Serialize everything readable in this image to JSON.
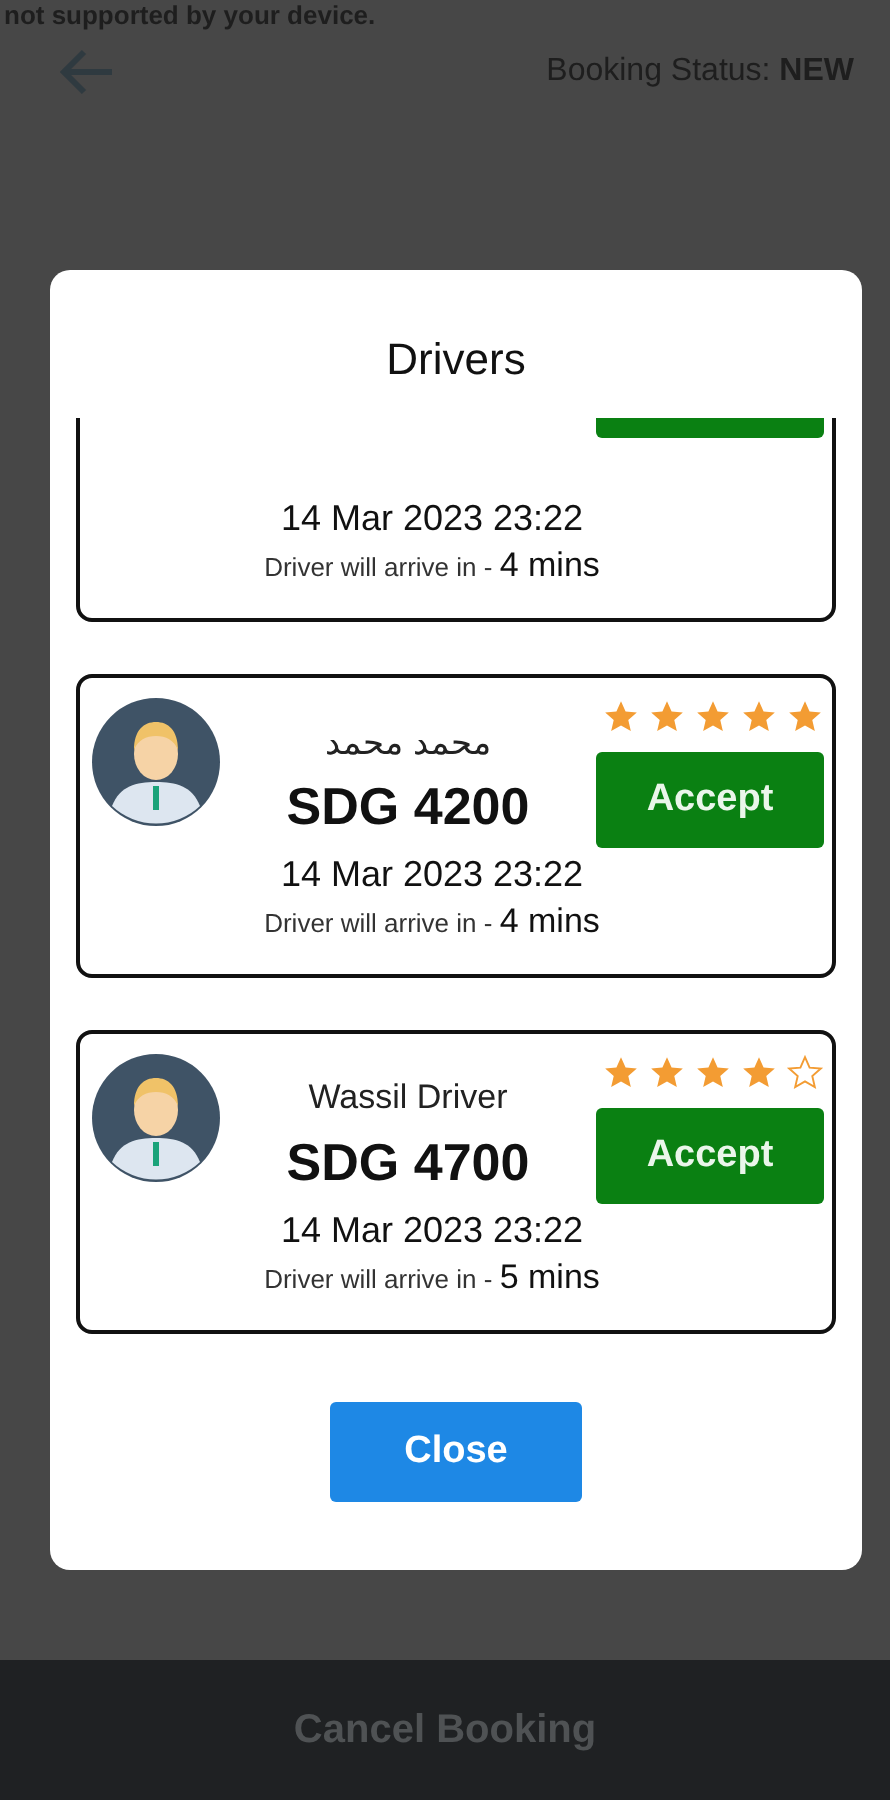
{
  "notice": "not supported by your device.",
  "header": {
    "status": "Booking Status: **NEW**"
  },
  "dialog": {
    "title": "Drivers",
    "drivers": [
      {
        "kind": "partial",
        "date": "14 Mar 2023 23:22",
        "arrival_label": "Driver will arrive in - ",
        "arrival_time": "4 mins"
      },
      {
        "kind": "full",
        "name": "محمد محمد",
        "plate": "SDG 4200",
        "stars": 5,
        "button_label": "Accept",
        "date": "14 Mar 2023 23:22",
        "arrival_label": "Driver will arrive in - ",
        "arrival_time": "4 mins"
      },
      {
        "kind": "full",
        "name": "Wassil Driver",
        "plate": "SDG 4700",
        "stars": 4,
        "button_label": "Accept",
        "date": "14 Mar 2023 23:22",
        "arrival_label": "Driver will arrive in - ",
        "arrival_time": "5 mins"
      }
    ],
    "close_label": "Close"
  },
  "footer": {
    "cancel_label": "Cancel Booking"
  }
}
